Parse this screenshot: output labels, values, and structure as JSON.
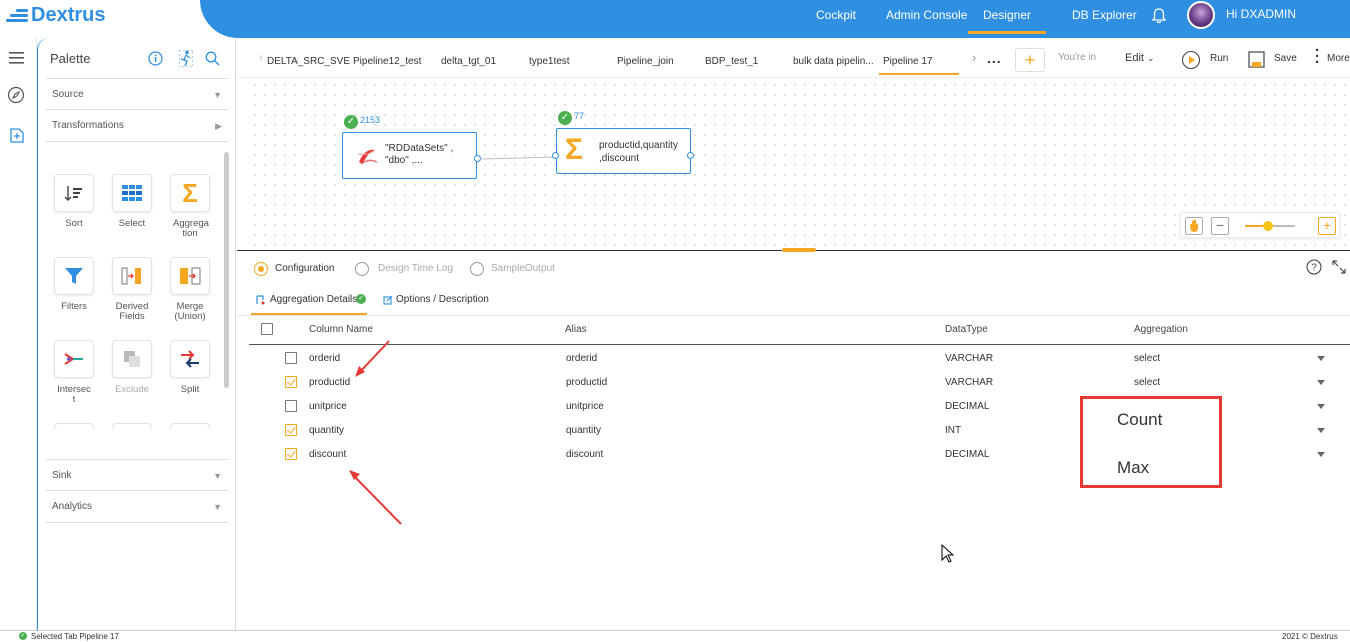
{
  "app": {
    "brand": "Dextrus"
  },
  "topnav": {
    "items": [
      {
        "label": "Cockpit"
      },
      {
        "label": "Admin Console"
      },
      {
        "label": "Designer",
        "active": true
      },
      {
        "label": "DB Explorer"
      }
    ],
    "user_greeting": "Hi DXADMIN"
  },
  "palette": {
    "title": "Palette",
    "sections": {
      "source": "Source",
      "transformations": "Transformations",
      "sink": "Sink",
      "analytics": "Analytics"
    },
    "tools": [
      {
        "label": "Sort",
        "icon": "sort-icon"
      },
      {
        "label": "Select",
        "icon": "select-grid-icon"
      },
      {
        "label": "Aggrega tion",
        "icon": "sigma-icon"
      },
      {
        "label": "Filters",
        "icon": "filter-icon"
      },
      {
        "label": "Derived Fields",
        "icon": "derived-fields-icon"
      },
      {
        "label": "Merge (Union)",
        "icon": "merge-icon"
      },
      {
        "label": "Intersec t",
        "icon": "intersect-icon"
      },
      {
        "label": "Exclude",
        "icon": "exclude-icon"
      },
      {
        "label": "Split",
        "icon": "split-icon"
      }
    ]
  },
  "pipeline_tabs": [
    "DELTA_SRC_SVE",
    "Pipeline12_test",
    "delta_tgt_01",
    "type1test",
    "Pipeline_join",
    "BDP_test_1",
    "bulk data pipelin...",
    "Pipeline 17"
  ],
  "active_tab": "Pipeline 17",
  "toolbar": {
    "overflow": "...",
    "add": "+",
    "youre_in": "You're in",
    "edit": "Edit",
    "run": "Run",
    "save": "Save",
    "more": "More"
  },
  "canvas": {
    "source_node": {
      "count": "2153",
      "line1": "\"RDDataSets\" ,",
      "line2": "\"dbo\" ,..."
    },
    "agg_node": {
      "count": "77",
      "line1": "productid,quantity",
      "line2": ",discount"
    },
    "zoom_level": 0.45
  },
  "config": {
    "radios": [
      {
        "label": "Configuration",
        "selected": true
      },
      {
        "label": "Design Time Log",
        "selected": false
      },
      {
        "label": "SampleOutput",
        "selected": false
      }
    ],
    "subtabs": {
      "agg_details": "Aggregation Details",
      "options": "Options / Description"
    },
    "columns": {
      "name": "Column Name",
      "alias": "Alias",
      "datatype": "DataType",
      "aggregation": "Aggregation"
    },
    "rows": [
      {
        "name": "orderid",
        "alias": "orderid",
        "datatype": "VARCHAR",
        "aggregation": "select",
        "checked": false
      },
      {
        "name": "productid",
        "alias": "productid",
        "datatype": "VARCHAR",
        "aggregation": "select",
        "checked": true
      },
      {
        "name": "unitprice",
        "alias": "unitprice",
        "datatype": "DECIMAL",
        "aggregation": "",
        "checked": false
      },
      {
        "name": "quantity",
        "alias": "quantity",
        "datatype": "INT",
        "aggregation": "",
        "checked": true
      },
      {
        "name": "discount",
        "alias": "discount",
        "datatype": "DECIMAL",
        "aggregation": "",
        "checked": true
      }
    ],
    "callout": {
      "line1": "Count",
      "line2": "Max"
    }
  },
  "statusbar": {
    "left": "Selected Tab Pipeline 17",
    "right": "2021 © Dextrus"
  }
}
